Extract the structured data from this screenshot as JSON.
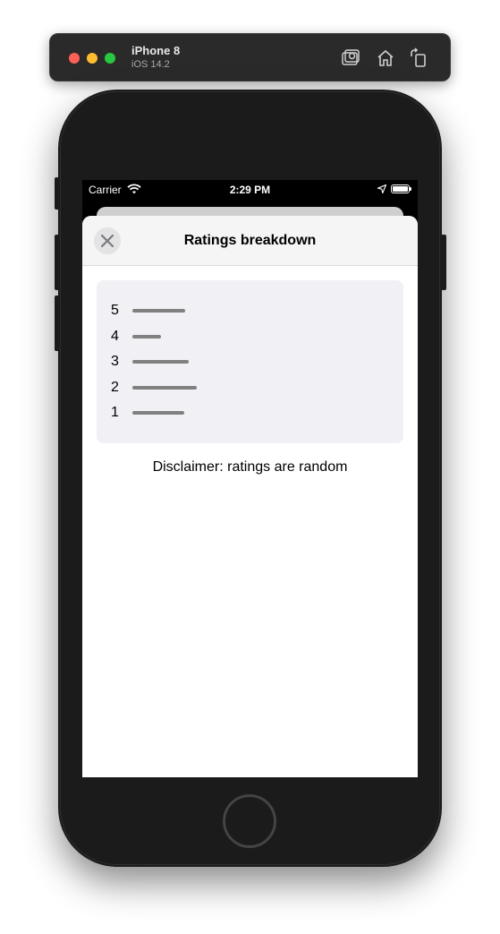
{
  "simulator": {
    "device_name": "iPhone 8",
    "os_version": "iOS 14.2",
    "icons": [
      "screenshot-icon",
      "home-icon",
      "rotate-icon"
    ]
  },
  "status_bar": {
    "carrier": "Carrier",
    "time": "2:29 PM"
  },
  "sheet": {
    "title": "Ratings breakdown",
    "close_icon": "close-icon",
    "ratings": [
      {
        "label": "5",
        "fraction": 0.82
      },
      {
        "label": "4",
        "fraction": 0.45
      },
      {
        "label": "3",
        "fraction": 0.88
      },
      {
        "label": "2",
        "fraction": 1.0
      },
      {
        "label": "1",
        "fraction": 0.81
      }
    ],
    "disclaimer": "Disclaimer: ratings are random"
  },
  "colors": {
    "bar": "#808080",
    "panel_background": "#f0f0f5",
    "traffic_red": "#fe5f57",
    "traffic_yellow": "#febc2e",
    "traffic_green": "#28c840"
  }
}
